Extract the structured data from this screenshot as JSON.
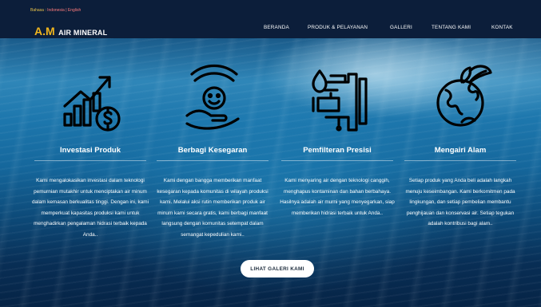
{
  "lang_bar": {
    "prefix": "Bahasa :",
    "options": "Indonesia | English"
  },
  "logo": {
    "brand": "A.M",
    "rest": "AIR MINERAL"
  },
  "nav": [
    "BERANDA",
    "PRODUK & PELAYANAN",
    "GALLERI",
    "TENTANG KAMI",
    "KONTAK"
  ],
  "features": [
    {
      "icon": "investment-chart-coin-icon",
      "title": "Investasi Produk",
      "text": "Kami mengalokasikan investasi dalam teknologi pemurnian mutakhir untuk menciptakan air minum dalam kemasan berkualitas tinggi. Dengan ini, kami memperkuat kapasitas produksi kami untuk menghadirkan pengalaman hidrasi terbaik kepada Anda.."
    },
    {
      "icon": "hands-happy-face-icon",
      "title": "Berbagi Kesegaran",
      "text": "Kami dengan bangga memberikan manfaat kesegaran kepada komunitas di wilayah produksi kami. Melalui aksi rutin memberikan produk air minum kami secara gratis, kami berbagi manfaat langsung dengan komunitas setempat dalam semangat kepedulian kami.."
    },
    {
      "icon": "water-pipe-filter-icon",
      "title": "Pemfilteran Presisi",
      "text": "Kami menyaring air dengan teknologi canggih, menghapus kontaminan dan bahan berbahaya. Hasilnya adalah air murni yang menyegarkan, siap memberikan hidrasi terbaik untuk Anda.."
    },
    {
      "icon": "earth-leaves-icon",
      "title": "Mengairi Alam",
      "text": "Setiap produk yang Anda beli adalah langkah menuju keseimbangan. Kami berkomitmen pada lingkungan, dan setiap pembelian membantu penghijauan dan konservasi air. Setiap tegukan adalah kontribusi bagi alam.."
    }
  ],
  "cta_label": "LIHAT GALERI KAMI",
  "colors": {
    "header": "#0c1e3a",
    "brand": "#f0b51e",
    "lang_link": "#ff7c7c"
  }
}
